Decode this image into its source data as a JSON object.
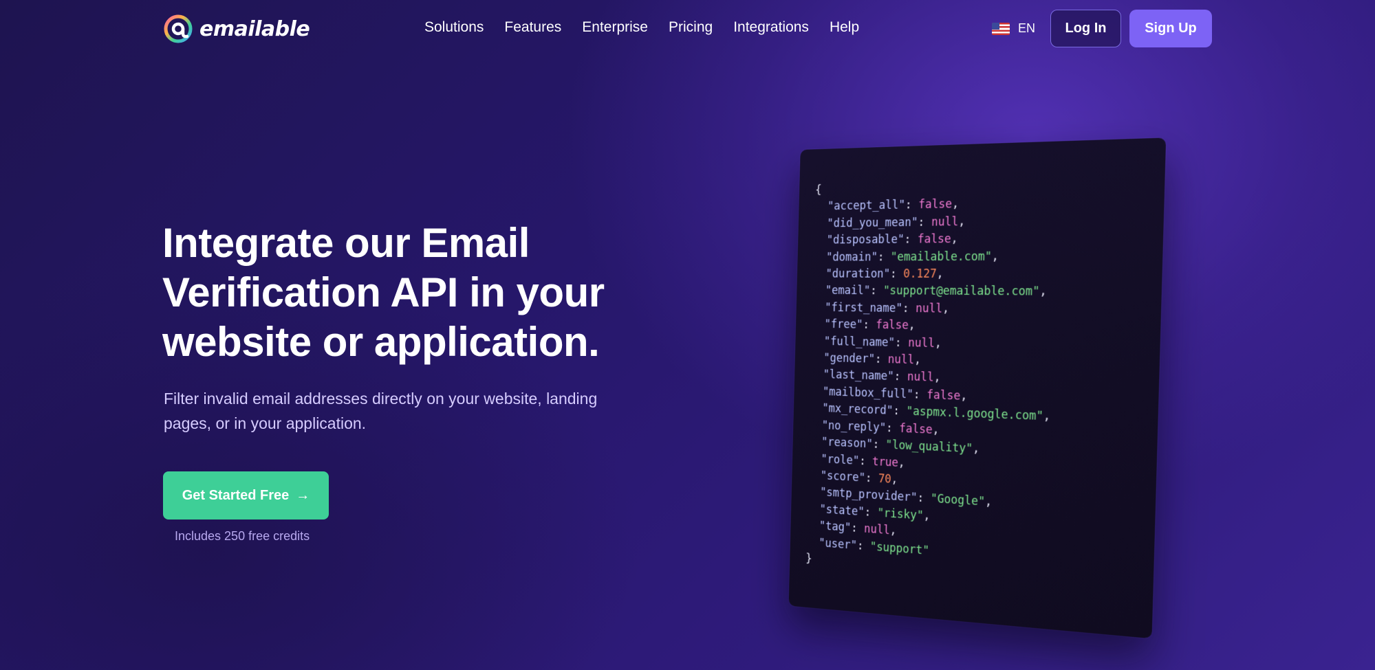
{
  "brand": {
    "name": "emailable"
  },
  "nav": {
    "items": [
      "Solutions",
      "Features",
      "Enterprise",
      "Pricing",
      "Integrations",
      "Help"
    ],
    "language": "EN",
    "login": "Log In",
    "signup": "Sign Up"
  },
  "hero": {
    "title": "Integrate our Email Verification API in your website or application.",
    "subtitle": "Filter invalid email addresses directly on your website, landing pages, or in your application.",
    "cta": "Get Started Free",
    "cta_arrow": "→",
    "note": "Includes 250 free credits"
  },
  "code": {
    "open": "{",
    "close": "}",
    "fields": [
      {
        "key": "\"accept_all\"",
        "value": "false",
        "type": "b"
      },
      {
        "key": "\"did_you_mean\"",
        "value": "null",
        "type": "b"
      },
      {
        "key": "\"disposable\"",
        "value": "false",
        "type": "b"
      },
      {
        "key": "\"domain\"",
        "value": "\"emailable.com\"",
        "type": "s"
      },
      {
        "key": "\"duration\"",
        "value": "0.127",
        "type": "n"
      },
      {
        "key": "\"email\"",
        "value": "\"support@emailable.com\"",
        "type": "s"
      },
      {
        "key": "\"first_name\"",
        "value": "null",
        "type": "b"
      },
      {
        "key": "\"free\"",
        "value": "false",
        "type": "b"
      },
      {
        "key": "\"full_name\"",
        "value": "null",
        "type": "b"
      },
      {
        "key": "\"gender\"",
        "value": "null",
        "type": "b"
      },
      {
        "key": "\"last_name\"",
        "value": "null",
        "type": "b"
      },
      {
        "key": "\"mailbox_full\"",
        "value": "false",
        "type": "b"
      },
      {
        "key": "\"mx_record\"",
        "value": "\"aspmx.l.google.com\"",
        "type": "s"
      },
      {
        "key": "\"no_reply\"",
        "value": "false",
        "type": "b"
      },
      {
        "key": "\"reason\"",
        "value": "\"low_quality\"",
        "type": "s"
      },
      {
        "key": "\"role\"",
        "value": "true",
        "type": "b"
      },
      {
        "key": "\"score\"",
        "value": "70",
        "type": "n"
      },
      {
        "key": "\"smtp_provider\"",
        "value": "\"Google\"",
        "type": "s"
      },
      {
        "key": "\"state\"",
        "value": "\"risky\"",
        "type": "s"
      },
      {
        "key": "\"tag\"",
        "value": "null",
        "type": "b"
      },
      {
        "key": "\"user\"",
        "value": "\"support\"",
        "type": "s"
      }
    ]
  }
}
